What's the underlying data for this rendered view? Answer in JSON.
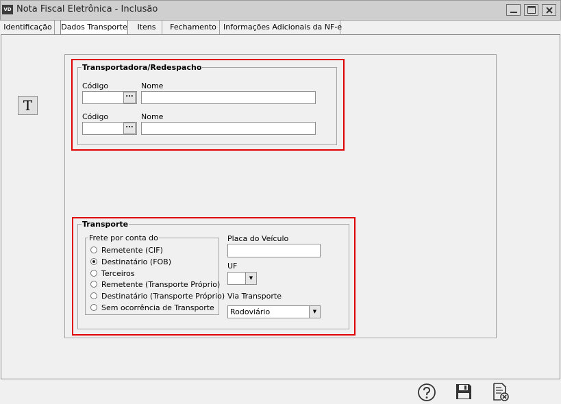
{
  "window": {
    "app_badge": "VD",
    "title": "Nota Fiscal Eletrônica - Inclusão"
  },
  "tabs": [
    {
      "label": "Identificação"
    },
    {
      "label": "Dados Transporte"
    },
    {
      "label": "Itens"
    },
    {
      "label": "Fechamento"
    },
    {
      "label": "Informações Adicionais da NF-e"
    }
  ],
  "side_button": {
    "label": "T"
  },
  "transportadora": {
    "title": "Transportadora/Redespacho",
    "row1": {
      "codigo_label": "Código",
      "codigo_value": "",
      "nome_label": "Nome",
      "nome_value": ""
    },
    "row2": {
      "codigo_label": "Código",
      "codigo_value": "",
      "nome_label": "Nome",
      "nome_value": ""
    },
    "lookup_glyph": "..."
  },
  "transporte": {
    "title": "Transporte",
    "frete": {
      "title": "Frete por conta do",
      "options": [
        {
          "label": "Remetente (CIF)",
          "selected": false
        },
        {
          "label": "Destinatário (FOB)",
          "selected": true
        },
        {
          "label": "Terceiros",
          "selected": false
        },
        {
          "label": "Remetente (Transporte Próprio)",
          "selected": false
        },
        {
          "label": "Destinatário (Transporte Próprio)",
          "selected": false
        },
        {
          "label": "Sem ocorrência de Transporte",
          "selected": false
        }
      ]
    },
    "placa_label": "Placa do Veículo",
    "placa_value": "",
    "uf_label": "UF",
    "uf_value": "",
    "via_label": "Via Transporte",
    "via_value": "Rodoviário"
  },
  "colors": {
    "highlight": "#e00000",
    "titlebar": "#cfcfcf",
    "panel_bg": "#f0f0f0"
  }
}
